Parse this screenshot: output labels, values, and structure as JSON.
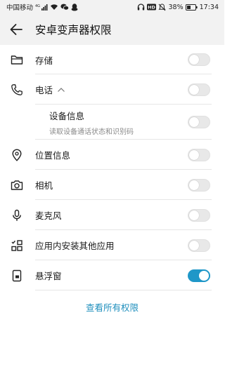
{
  "status_bar": {
    "carrier": "中国移动",
    "signal_label": "4G",
    "battery": "38%",
    "time": "17:34",
    "hd_badge": "HD",
    "left_icons": [
      "signal-icon",
      "wifi-icon",
      "wechat-icon",
      "qq-icon"
    ],
    "right_icons": [
      "headset-icon",
      "hd-icon",
      "mute-icon",
      "battery-icon"
    ]
  },
  "header": {
    "title": "安卓变声器权限",
    "back_icon": "back-arrow-icon"
  },
  "permissions": [
    {
      "label": "存储",
      "icon": "folder-icon",
      "enabled": false
    },
    {
      "label": "电话",
      "icon": "phone-icon",
      "enabled": false,
      "expanded": true
    },
    {
      "label": "设备信息",
      "subtitle": "读取设备通话状态和识别码",
      "enabled": false,
      "nested": true
    },
    {
      "label": "位置信息",
      "icon": "location-icon",
      "enabled": false
    },
    {
      "label": "相机",
      "icon": "camera-icon",
      "enabled": false
    },
    {
      "label": "麦克风",
      "icon": "microphone-icon",
      "enabled": false
    },
    {
      "label": "应用内安装其他应用",
      "icon": "install-apps-icon",
      "enabled": false
    },
    {
      "label": "悬浮窗",
      "icon": "floating-window-icon",
      "enabled": true
    }
  ],
  "footer": {
    "view_all": "查看所有权限"
  },
  "colors": {
    "accent": "#1f97c8",
    "link": "#1f8fbd",
    "toggle_off": "#e8e8e8"
  }
}
